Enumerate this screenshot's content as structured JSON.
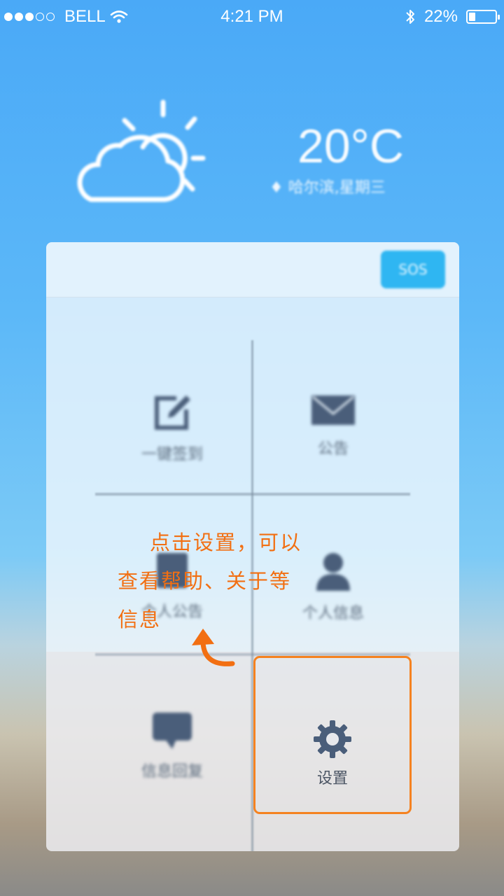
{
  "status_bar": {
    "carrier": "BELL",
    "time": "4:21 PM",
    "battery_percent": "22%",
    "signal_bars_filled": 3,
    "signal_bars_total": 5
  },
  "weather": {
    "temperature": "20°C",
    "location": "♦ 哈尔滨,星期三",
    "icon": "partly-cloudy-icon"
  },
  "panel": {
    "sos_label": "SOS",
    "tiles": [
      {
        "label": "一键签到",
        "icon": "edit-icon"
      },
      {
        "label": "公告",
        "icon": "mail-icon"
      },
      {
        "label": "个人公告",
        "icon": "document-icon"
      },
      {
        "label": "个人信息",
        "icon": "person-icon"
      },
      {
        "label": "信息回复",
        "icon": "chat-icon"
      }
    ],
    "settings": {
      "label": "设置",
      "icon": "gear-icon"
    }
  },
  "hint": {
    "lines": [
      "点击设置，可以",
      "查看帮助、关于等",
      "信息"
    ],
    "color": "#f26f12"
  },
  "colors": {
    "highlight": "#f58220",
    "sos": "#2fb6f2",
    "icon": "#4a5e7a"
  }
}
